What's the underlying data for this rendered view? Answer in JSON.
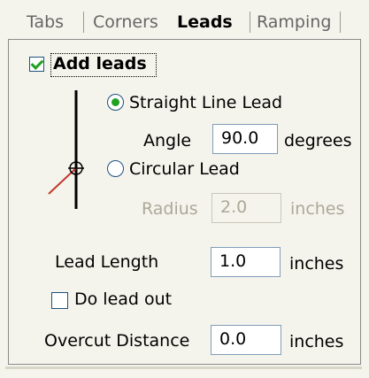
{
  "tabs": [
    {
      "label": "Tabs",
      "active": false
    },
    {
      "label": "Corners",
      "active": false
    },
    {
      "label": "Leads",
      "active": true
    },
    {
      "label": "Ramping",
      "active": false
    }
  ],
  "add_leads": {
    "label": "Add leads",
    "checked": true
  },
  "straight_line": {
    "label": "Straight Line Lead",
    "selected": true
  },
  "angle": {
    "label": "Angle",
    "value": "90.0",
    "unit": "degrees"
  },
  "circular": {
    "label": "Circular Lead",
    "selected": false
  },
  "radius": {
    "label": "Radius",
    "value": "2.0",
    "unit": "inches",
    "enabled": false
  },
  "lead_length": {
    "label": "Lead Length",
    "value": "1.0",
    "unit": "inches"
  },
  "lead_out": {
    "label": "Do lead out",
    "checked": false
  },
  "overcut": {
    "label": "Overcut Distance",
    "value": "0.0",
    "unit": "inches"
  },
  "icons": {
    "lead_diagram": "lead-diagram-icon"
  },
  "colors": {
    "check": "#21a121",
    "border": "#1c5180",
    "lead_line": "#c0392b"
  }
}
